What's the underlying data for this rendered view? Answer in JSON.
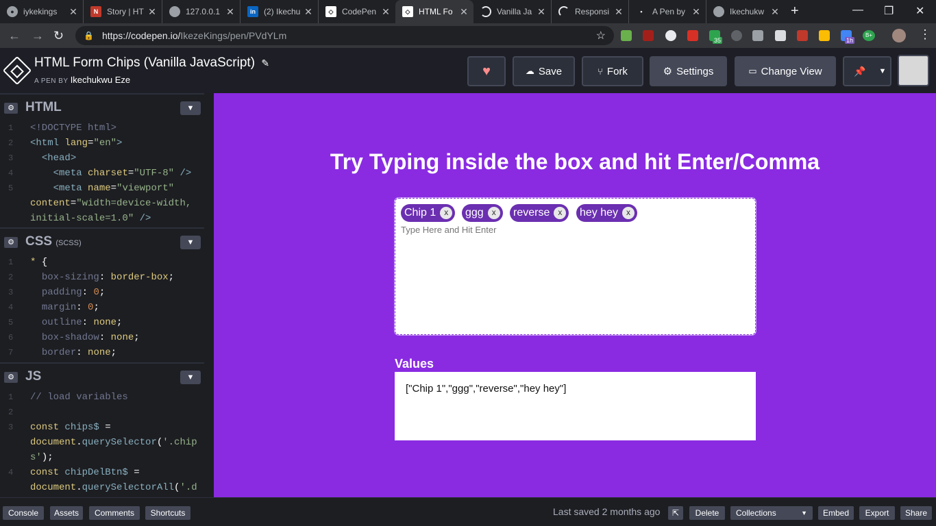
{
  "browser": {
    "tabs": [
      {
        "title": "iykekings",
        "icon": "github-icon",
        "active": false
      },
      {
        "title": "Story | HT",
        "icon": "nsu-icon",
        "active": false
      },
      {
        "title": "127.0.0.1",
        "icon": "globe-icon",
        "active": false
      },
      {
        "title": "(2) Ikechu",
        "icon": "linkedin-icon",
        "active": false
      },
      {
        "title": "CodePen",
        "icon": "codepen-icon",
        "active": false
      },
      {
        "title": "HTML Fo",
        "icon": "codepen-icon",
        "active": true
      },
      {
        "title": "Vanilla Ja",
        "icon": "loading-icon",
        "active": false
      },
      {
        "title": "Responsi",
        "icon": "loading-icon",
        "active": false
      },
      {
        "title": "A Pen by",
        "icon": "dot-icon",
        "active": false
      },
      {
        "title": "Ikechukw",
        "icon": "globe-icon",
        "active": false
      }
    ],
    "url_prefix": "https://codepen.io/",
    "url_rest": "IkezeKings/pen/PVdYLm",
    "ext_badges": {
      "badge1": "35",
      "badge2": "1h",
      "badge3": "B+"
    }
  },
  "header": {
    "title": "HTML Form Chips (Vanilla JavaScript)",
    "by_label": "A PEN BY",
    "author": "Ikechukwu Eze",
    "buttons": {
      "save": "Save",
      "fork": "Fork",
      "settings": "Settings",
      "change_view": "Change View"
    }
  },
  "panels": {
    "html": {
      "name": "HTML"
    },
    "css": {
      "name": "CSS",
      "sub": "(SCSS)"
    },
    "js": {
      "name": "JS"
    }
  },
  "result": {
    "title": "Try Typing inside the box and hit Enter/Comma",
    "chips": [
      "Chip 1",
      "ggg",
      "reverse",
      "hey hey"
    ],
    "chip_close": "x",
    "placeholder": "Type Here and Hit Enter",
    "values_label": "Values",
    "values_text": "[\"Chip 1\",\"ggg\",\"reverse\",\"hey hey\"]",
    "accent": "#8a2be2"
  },
  "footer": {
    "console": "Console",
    "assets": "Assets",
    "comments": "Comments",
    "shortcuts": "Shortcuts",
    "last_saved": "Last saved 2 months ago",
    "delete": "Delete",
    "collections": "Collections",
    "embed": "Embed",
    "export": "Export",
    "share": "Share"
  }
}
